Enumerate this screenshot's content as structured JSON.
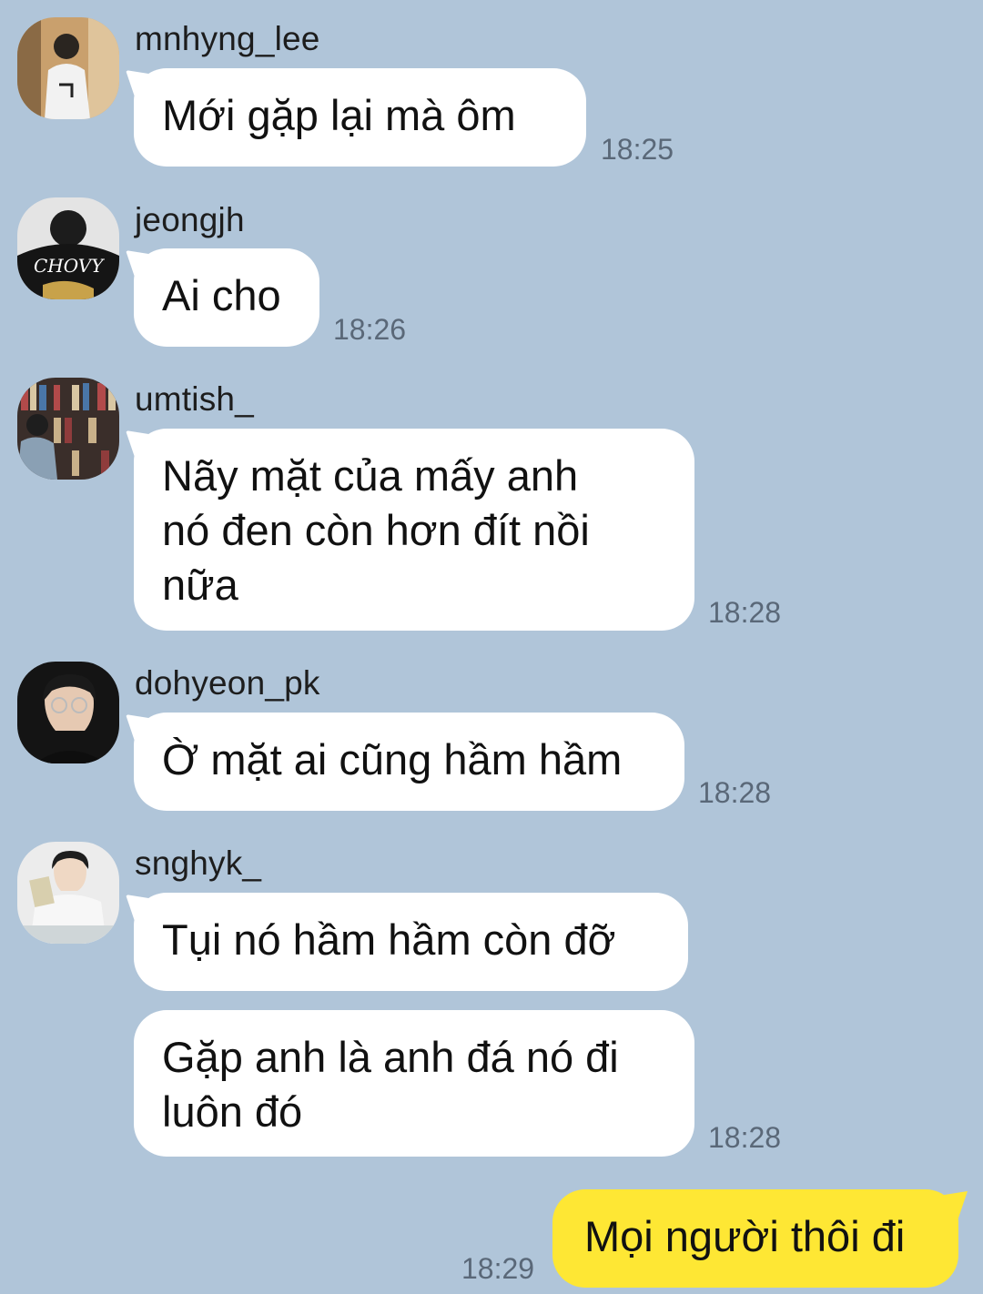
{
  "colors": {
    "background": "#b0c5d9",
    "incoming_bubble": "#ffffff",
    "outgoing_bubble": "#fee734",
    "timestamp": "#5a6878"
  },
  "messages": [
    {
      "sender": "mnhyng_lee",
      "avatar": "avatar-icon",
      "text": "Mới gặp lại mà ôm",
      "time": "18:25"
    },
    {
      "sender": "jeongjh",
      "avatar": "avatar-icon",
      "text": "Ai cho",
      "time": "18:26"
    },
    {
      "sender": "umtish_",
      "avatar": "avatar-icon",
      "text": "Nãy mặt của mấy anh\nnó đen còn hơn đít nồi\nnữa",
      "time": "18:28"
    },
    {
      "sender": "dohyeon_pk",
      "avatar": "avatar-icon",
      "text": "Ờ mặt ai cũng hầm hầm",
      "time": "18:28"
    },
    {
      "sender": "snghyk_",
      "avatar": "avatar-icon",
      "text": "Tụi nó hầm hầm còn đỡ",
      "time": ""
    },
    {
      "sender": "",
      "avatar": "",
      "text": "Gặp anh là anh đá nó đi\nluôn đó",
      "time": "18:28"
    }
  ],
  "outgoing": {
    "text": "Mọi người thôi đi",
    "time": "18:29"
  }
}
